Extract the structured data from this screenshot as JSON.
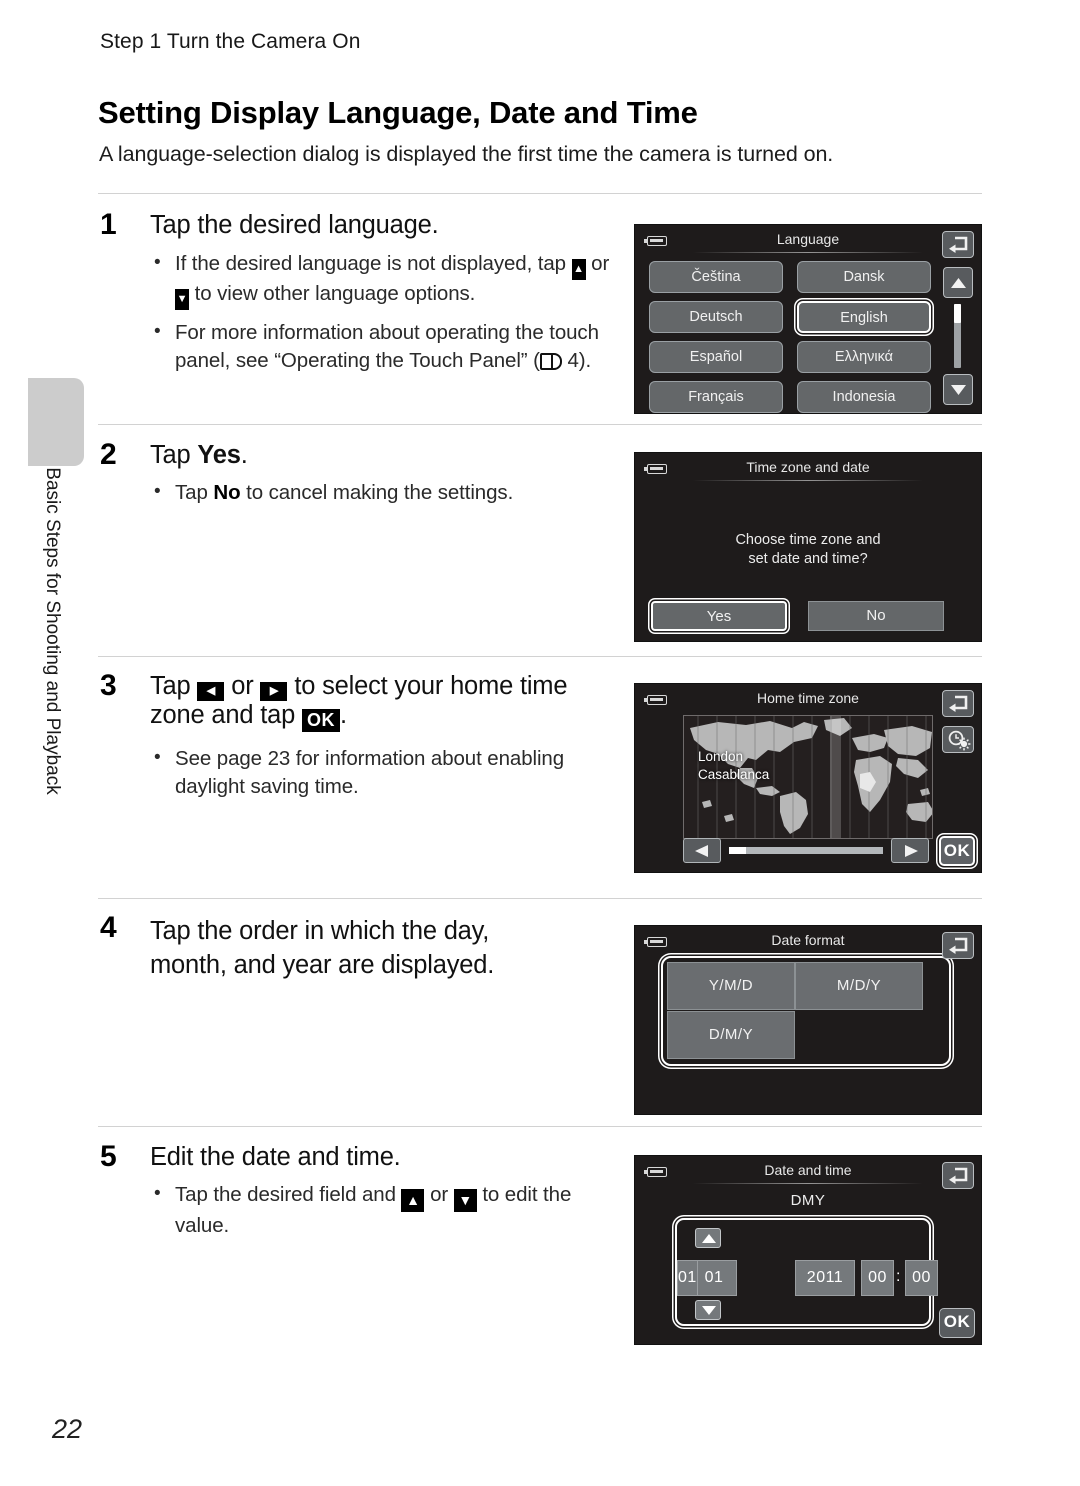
{
  "document": {
    "running_header": "Step 1 Turn the Camera On",
    "section_title": "Setting Display Language, Date and Time",
    "section_intro": "A language-selection dialog is displayed the first time the camera is turned on.",
    "side_tab_label": "Basic Steps for Shooting and Playback",
    "page_number": "22"
  },
  "steps": {
    "step1": {
      "number": "1",
      "title": "Tap the desired language.",
      "bullet1_a": "If the desired language is not displayed, tap ",
      "bullet1_b": " or ",
      "bullet1_c": " to view other language options.",
      "bullet2_a": "For more information about operating the touch panel, see “Operating the Touch Panel” (",
      "bullet2_b": " 4)."
    },
    "step2": {
      "number": "2",
      "title_a": "Tap ",
      "title_b": "Yes",
      "title_c": ".",
      "bullet_a": "Tap ",
      "bullet_b": "No",
      "bullet_c": " to cancel making the settings."
    },
    "step3": {
      "number": "3",
      "title_a": "Tap ",
      "title_b": " or ",
      "title_c": " to select your home time zone and tap ",
      "title_d": ".",
      "bullet": "See page 23 for information about enabling daylight saving time."
    },
    "step4": {
      "number": "4",
      "title": "Tap the order in which the day, month, and year are displayed."
    },
    "step5": {
      "number": "5",
      "title": "Edit the date and time.",
      "bullet_a": "Tap the desired field and ",
      "bullet_b": " or ",
      "bullet_c": " to edit the value."
    }
  },
  "screens": {
    "language": {
      "title": "Language",
      "options": [
        "Čeština",
        "Dansk",
        "Deutsch",
        "English",
        "Español",
        "Ελληνικά",
        "Français",
        "Indonesia"
      ],
      "selected": "English",
      "back_icon": "back-arrow-icon",
      "scroll_up_icon": "scroll-up-icon",
      "scroll_down_icon": "scroll-down-icon"
    },
    "timezone_confirm": {
      "title": "Time zone and date",
      "message_line1": "Choose time zone and",
      "message_line2": "set date and time?",
      "yes_label": "Yes",
      "no_label": "No",
      "selected": "Yes"
    },
    "home_time_zone": {
      "title": "Home time zone",
      "city_line1": "London",
      "city_line2": "Casablanca",
      "prev_icon": "left-arrow-icon",
      "next_icon": "right-arrow-icon",
      "ok_label": "OK",
      "dst_icon": "daylight-saving-icon",
      "back_icon": "back-arrow-icon"
    },
    "date_format": {
      "title": "Date format",
      "options": [
        "Y/M/D",
        "M/D/Y",
        "D/M/Y"
      ],
      "back_icon": "back-arrow-icon"
    },
    "date_and_time": {
      "title": "Date and time",
      "format_label": "DMY",
      "fields": [
        "01",
        "01",
        "2011",
        "00",
        "00"
      ],
      "separator": ":",
      "up_icon": "increment-arrow-icon",
      "down_icon": "decrement-arrow-icon",
      "ok_label": "OK",
      "back_icon": "back-arrow-icon"
    }
  },
  "glyphs": {
    "up": "▲",
    "down": "▼",
    "left": "◀",
    "right": "▶",
    "ok": "OK"
  }
}
